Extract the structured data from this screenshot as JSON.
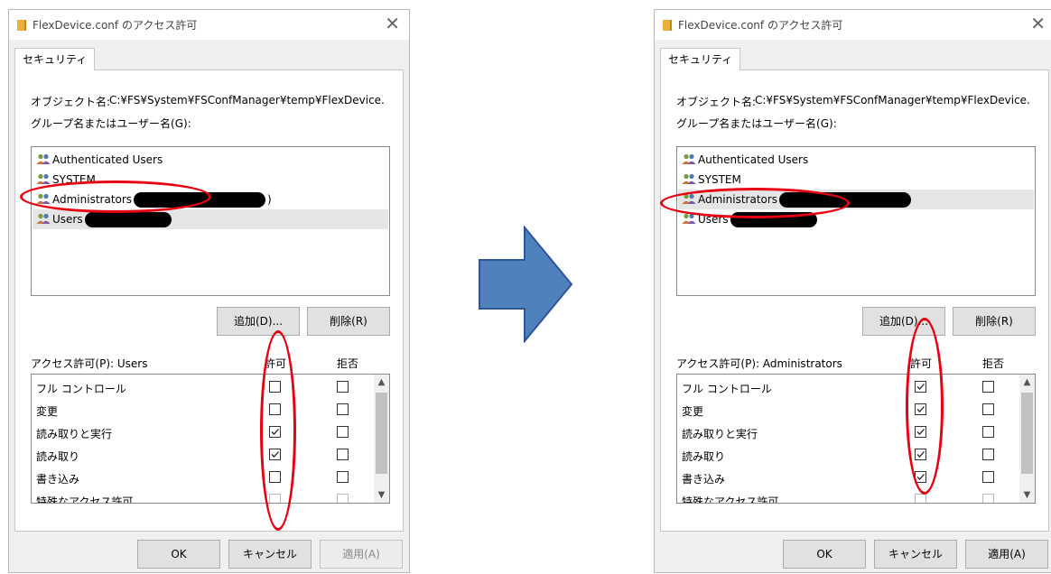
{
  "dialogs": [
    {
      "title": "FlexDevice.conf のアクセス許可",
      "close_glyph": "✕",
      "tab": "セキュリティ",
      "object_label": "オブジェクト名:",
      "object_path": "C:¥FS¥System¥FSConfManager¥temp¥FlexDevice.",
      "group_label": "グループ名またはユーザー名(G):",
      "users": [
        {
          "name": "Authenticated Users",
          "selected": false
        },
        {
          "name": "SYSTEM",
          "selected": false
        },
        {
          "name": "Administrators",
          "suffix": ")",
          "selected": false
        },
        {
          "name": "Users",
          "selected": true
        }
      ],
      "add_button": "追加(D)...",
      "remove_button": "削除(R)",
      "perm_label": "アクセス許可(P): Users",
      "allow_col": "許可",
      "deny_col": "拒否",
      "permissions": [
        {
          "name": "フル コントロール",
          "allow": false,
          "deny": false
        },
        {
          "name": "変更",
          "allow": false,
          "deny": false
        },
        {
          "name": "読み取りと実行",
          "allow": true,
          "deny": false
        },
        {
          "name": "読み取り",
          "allow": true,
          "deny": false
        },
        {
          "name": "書き込み",
          "allow": false,
          "deny": false
        },
        {
          "name": "特殊なアクセス許可",
          "allow": false,
          "deny": false
        }
      ],
      "ok_button": "OK",
      "cancel_button": "キャンセル",
      "apply_button": "適用(A)",
      "apply_enabled": false
    },
    {
      "title": "FlexDevice.conf のアクセス許可",
      "close_glyph": "✕",
      "tab": "セキュリティ",
      "object_label": "オブジェクト名:",
      "object_path": "C:¥FS¥System¥FSConfManager¥temp¥FlexDevice.",
      "group_label": "グループ名またはユーザー名(G):",
      "users": [
        {
          "name": "Authenticated Users",
          "selected": false
        },
        {
          "name": "SYSTEM",
          "selected": false
        },
        {
          "name": "Administrators",
          "suffix": "",
          "selected": true
        },
        {
          "name": "Users",
          "selected": false
        }
      ],
      "add_button": "追加(D)...",
      "remove_button": "削除(R)",
      "perm_label": "アクセス許可(P): Administrators",
      "allow_col": "許可",
      "deny_col": "拒否",
      "permissions": [
        {
          "name": "フル コントロール",
          "allow": true,
          "deny": false
        },
        {
          "name": "変更",
          "allow": true,
          "deny": false
        },
        {
          "name": "読み取りと実行",
          "allow": true,
          "deny": false
        },
        {
          "name": "読み取り",
          "allow": true,
          "deny": false
        },
        {
          "name": "書き込み",
          "allow": true,
          "deny": false
        },
        {
          "name": "特殊なアクセス許可",
          "allow": false,
          "deny": false
        }
      ],
      "ok_button": "OK",
      "cancel_button": "キャンセル",
      "apply_button": "適用(A)",
      "apply_enabled": true
    }
  ],
  "icons": {
    "title": "folder-icon",
    "user": "users-group-icon",
    "arrow": "right-arrow-icon",
    "scroll_up": "chevron-up-icon",
    "scroll_down": "chevron-down-icon"
  },
  "colors": {
    "annotation": "#e60012",
    "arrow_fill": "#4f81bd",
    "arrow_stroke": "#2f5597"
  }
}
